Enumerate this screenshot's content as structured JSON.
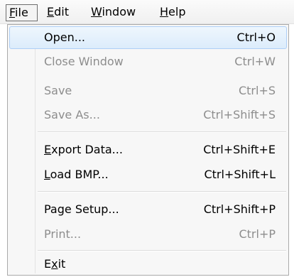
{
  "menubar": {
    "file": {
      "before": "",
      "mnemonic": "F",
      "after": "ile"
    },
    "edit": {
      "before": "",
      "mnemonic": "E",
      "after": "dit"
    },
    "window": {
      "before": "",
      "mnemonic": "W",
      "after": "indow"
    },
    "help": {
      "before": "",
      "mnemonic": "H",
      "after": "elp"
    }
  },
  "file_menu": {
    "open": {
      "label": "Open...",
      "shortcut": "Ctrl+O"
    },
    "close_window": {
      "label": "Close Window",
      "shortcut": "Ctrl+W"
    },
    "save": {
      "label": "Save",
      "shortcut": "Ctrl+S"
    },
    "save_as": {
      "label": "Save As...",
      "shortcut": "Ctrl+Shift+S"
    },
    "export_data": {
      "before": "",
      "mnemonic": "E",
      "after": "xport Data...",
      "shortcut": "Ctrl+Shift+E"
    },
    "load_bmp": {
      "before": "",
      "mnemonic": "L",
      "after": "oad BMP...",
      "shortcut": "Ctrl+Shift+L"
    },
    "page_setup": {
      "label": "Page Setup...",
      "shortcut": "Ctrl+Shift+P"
    },
    "print": {
      "label": "Print...",
      "shortcut": "Ctrl+P"
    },
    "exit": {
      "before": "E",
      "mnemonic": "x",
      "after": "it"
    }
  },
  "colors": {
    "disabled_text": "#8d8d8d",
    "highlight_border": "#aecff7",
    "highlight_fill": "#dcecfb",
    "menu_background": "#f7f7f7"
  }
}
